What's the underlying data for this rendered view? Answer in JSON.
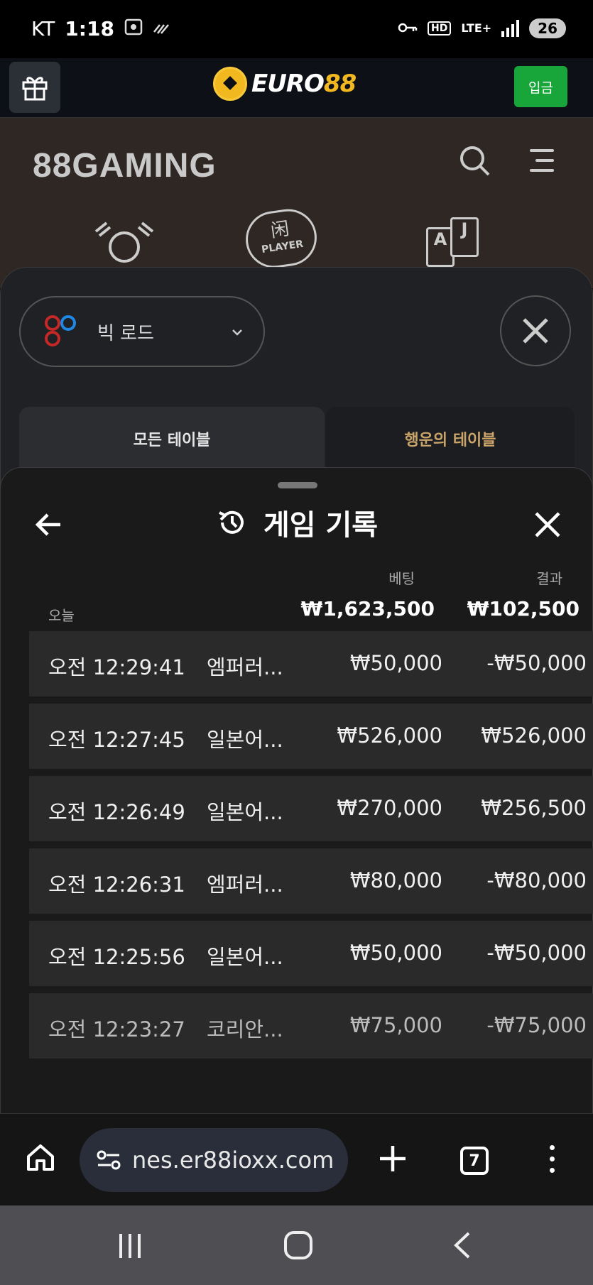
{
  "status_bar": {
    "carrier": "KT",
    "time": "1:18",
    "network": "LTE+",
    "network_badge": "HD",
    "battery": "26"
  },
  "site_header": {
    "brand_prefix": "EURO",
    "brand_suffix": "88",
    "deposit_label": "입금",
    "accent_color": "#f2b81f",
    "deposit_color": "#18a63a"
  },
  "gaming": {
    "logo": "88GAMING",
    "category_badge": "PLAYER",
    "category_hanzi": "闲",
    "card_letters": [
      "A",
      "J"
    ]
  },
  "modal_road": {
    "selected_road": "빅 로드",
    "tabs": [
      "모든 테이블",
      "행운의 테이블"
    ]
  },
  "history": {
    "title": "게임 기록",
    "col_bet": "베팅",
    "col_result": "결과",
    "today_label": "오늘",
    "total_bet": "₩1,623,500",
    "total_result": "₩102,500",
    "rows": [
      {
        "time": "오전 12:29:41",
        "game": "엠퍼러...",
        "bet": "₩50,000",
        "result": "-₩50,000"
      },
      {
        "time": "오전 12:27:45",
        "game": "일본어...",
        "bet": "₩526,000",
        "result": "₩526,000"
      },
      {
        "time": "오전 12:26:49",
        "game": "일본어...",
        "bet": "₩270,000",
        "result": "₩256,500"
      },
      {
        "time": "오전 12:26:31",
        "game": "엠퍼러...",
        "bet": "₩80,000",
        "result": "-₩80,000"
      },
      {
        "time": "오전 12:25:56",
        "game": "일본어...",
        "bet": "₩50,000",
        "result": "-₩50,000"
      },
      {
        "time": "오전 12:23:27",
        "game": "코리안...",
        "bet": "₩75,000",
        "result": "-₩75,000"
      }
    ]
  },
  "browser": {
    "url": "nes.er88ioxx.com",
    "tab_count": "7"
  }
}
